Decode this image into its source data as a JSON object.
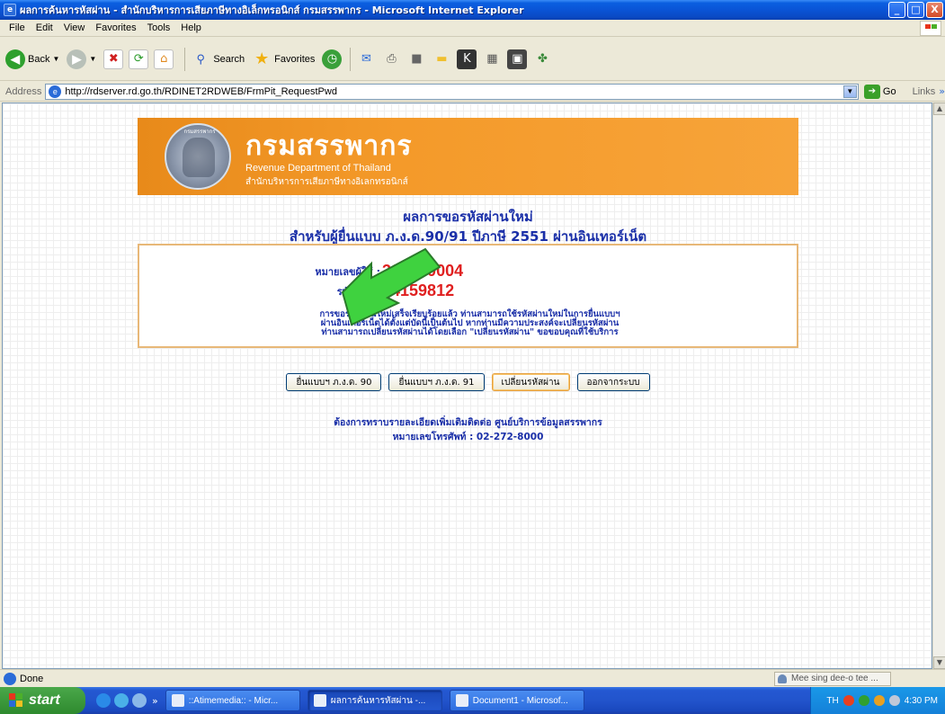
{
  "window": {
    "title": "ผลการค้นหารหัสผ่าน - สำนักบริหารการเสียภาษีทางอิเล็กทรอนิกส์ กรมสรรพากร - Microsoft Internet Explorer",
    "controls": [
      "_",
      "□",
      "X"
    ]
  },
  "menu": [
    "File",
    "Edit",
    "View",
    "Favorites",
    "Tools",
    "Help"
  ],
  "toolbar": {
    "back_label": "Back",
    "search_label": "Search",
    "favorites_label": "Favorites"
  },
  "address": {
    "label": "Address",
    "url": "http://rdserver.rd.go.th/RDINET2RDWEB/FrmPit_RequestPwd",
    "go_label": "Go",
    "links_label": "Links"
  },
  "banner": {
    "title": "กรมสรรพากร",
    "subtitle_en": "Revenue Department of Thailand",
    "subtitle_th": "สำนักบริหารการเสียภาษีทางอิเลกทรอนิกส์"
  },
  "result": {
    "title": "ผลการขอรหัสผ่านใหม่",
    "subtitle": "สำหรับผู้ยื่นแบบ ภ.ง.ด.90/91 ปีภาษี 2551 ผ่านอินเทอร์เน็ต",
    "user_label": "หมายเลขผู้ใช้ :",
    "user_value": "360980004",
    "password_label": "รหัสผ่าน :",
    "password_value": "34159812",
    "note_line1": "การขอรหัสผ่านใหม่เสร็จเรียบร้อยแล้ว ท่านสามารถใช้รหัสผ่านใหม่ในการยื่นแบบฯ",
    "note_line2": "ผ่านอินเทอร์เน็ตได้ตั้งแต่บัดนี้เป็นต้นไป หากท่านมีความประสงค์จะเปลี่ยนรหัสผ่าน",
    "note_line3": "ท่านสามารถเปลี่ยนรหัสผ่านได้โดยเลือก \"เปลี่ยนรหัสผ่าน\" ขอขอบคุณที่ใช้บริการ"
  },
  "buttons": {
    "file90": "ยื่นแบบฯ ภ.ง.ด. 90",
    "file91": "ยื่นแบบฯ ภ.ง.ด. 91",
    "change_pwd": "เปลี่ยนรหัสผ่าน",
    "logout": "ออกจากระบบ"
  },
  "contact": {
    "line1": "ต้องการทราบรายละเอียดเพิ่มเติมติดต่อ ศูนย์บริการข้อมูลสรรพากร",
    "line2": "หมายเลขโทรศัพท์ : 02-272-8000"
  },
  "status": {
    "text": "Done",
    "right_text": "Mee sing dee-o tee ..."
  },
  "taskbar": {
    "start_label": "start",
    "tasks": [
      {
        "label": "::Atimemedia:: - Micr..."
      },
      {
        "label": "ผลการค้นหารหัสผ่าน -..."
      },
      {
        "label": "Document1 - Microsof..."
      }
    ],
    "tray_lang": "TH",
    "clock": "4:30 PM"
  },
  "colors": {
    "banner_orange": "#f49a2a",
    "heading_blue": "#1a2fa8",
    "value_red": "#e02020",
    "arrow_green": "#3fd23f"
  }
}
